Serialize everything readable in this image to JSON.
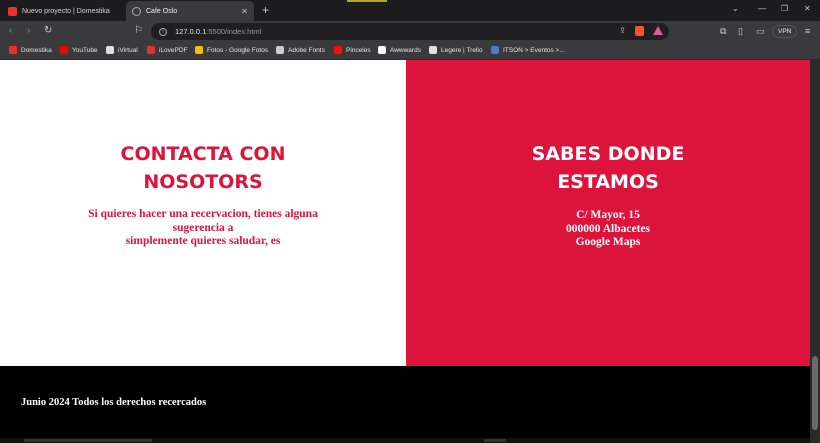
{
  "tabs": [
    {
      "label": "Nuevo proyecto | Domestika",
      "active": false
    },
    {
      "label": "Cafe Oslo",
      "active": true
    }
  ],
  "toolbar": {
    "url_host": "127.0.0.1",
    "url_path": ":5500/index.html",
    "vpn_label": "VPN"
  },
  "bookmarks": [
    {
      "label": "Domestika",
      "color": "#e8302c"
    },
    {
      "label": "YouTube",
      "color": "#ff0000"
    },
    {
      "label": "iVirtual",
      "color": "#e0e0e0"
    },
    {
      "label": "iLovePDF",
      "color": "#e5322d"
    },
    {
      "label": "Fotos - Google Fotos",
      "color": "#fbbc04"
    },
    {
      "label": "Adobe Fonts",
      "color": "#cccccc"
    },
    {
      "label": "Pinceles",
      "color": "#fa0f00"
    },
    {
      "label": "Awwwards",
      "color": "#ffffff"
    },
    {
      "label": "Legere | Trello",
      "color": "#e0e0e0"
    },
    {
      "label": "ITSON > Eventos >...",
      "color": "#4a7bd0"
    }
  ],
  "contact": {
    "heading_line1": "CONTACTA CON",
    "heading_line2": "NOSOTORS",
    "text_line1": "Si quieres hacer una recervacion, tienes alguna",
    "text_line2": "sugerencia a",
    "text_line3": "simplemente quieres saludar, es"
  },
  "location": {
    "heading_line1": "SABES DONDE",
    "heading_line2": "ESTAMOS",
    "address_line1": "C/ Mayor, 15",
    "address_line2": "000000 Albacetes",
    "address_line3": "Google Maps"
  },
  "footer": {
    "text": "Junio 2024 Todos los derechos recercados"
  },
  "colors": {
    "brand_red": "#dc143c",
    "footer_bg": "#000000"
  }
}
